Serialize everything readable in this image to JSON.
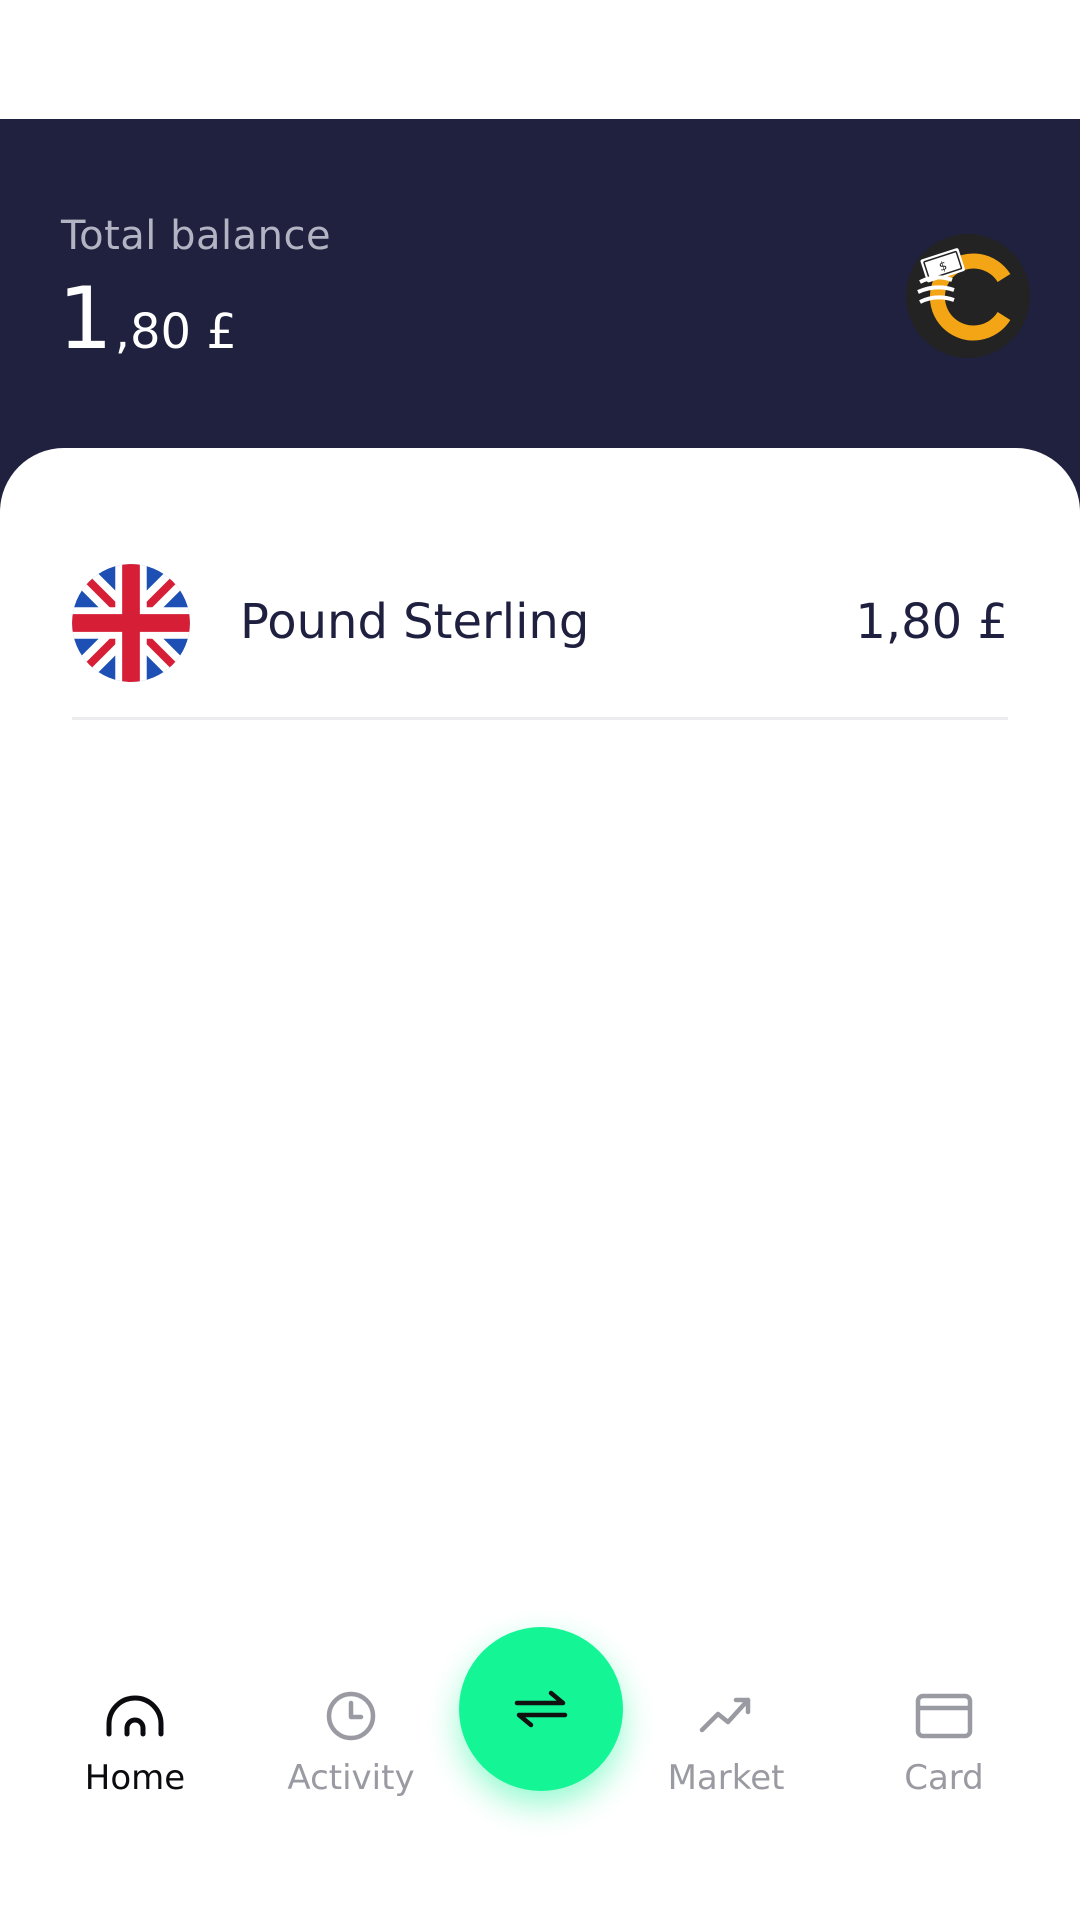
{
  "header": {
    "balance_label": "Total balance",
    "balance_int": "1",
    "balance_frac": ",80 £",
    "background": "#20213f"
  },
  "accounts": [
    {
      "name": "Pound Sterling",
      "value": "1,80 £",
      "flag_icon": "uk-flag-icon"
    }
  ],
  "nav": {
    "items": [
      {
        "label": "Home",
        "icon": "home-icon",
        "active": true
      },
      {
        "label": "Activity",
        "icon": "clock-icon",
        "active": false
      },
      {
        "label": "Market",
        "icon": "trend-icon",
        "active": false
      },
      {
        "label": "Card",
        "icon": "card-icon",
        "active": false
      }
    ],
    "fab_icon": "transfer-icon",
    "fab_color": "#14f596"
  }
}
